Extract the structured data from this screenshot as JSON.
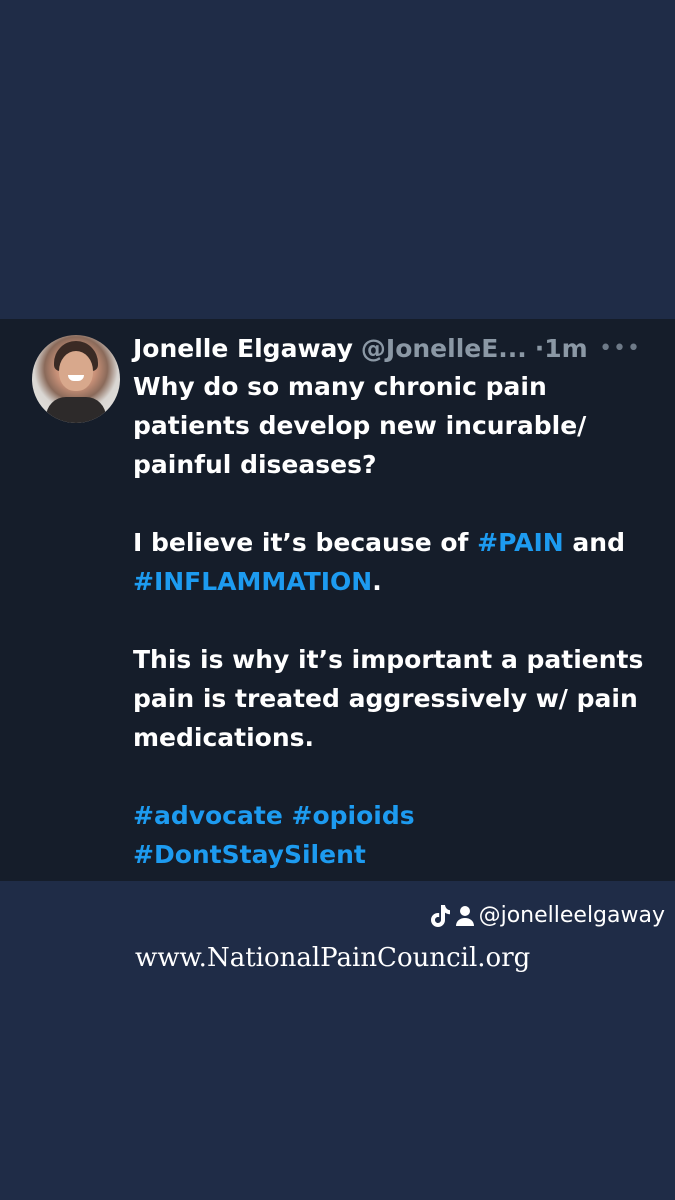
{
  "tweet": {
    "author": {
      "display_name": "Jonelle Elgaway",
      "handle": "@JonelleE...",
      "separator": "·",
      "time": "1m",
      "more_icon": "more-horizontal-icon"
    },
    "paragraphs": [
      [
        "Why do so many chronic pain patients develop new incurable/ painful diseases?"
      ],
      [
        "I believe it’s because of ",
        "#PAIN",
        " and ",
        "#INFLAMMATION",
        "."
      ],
      [
        "This is why it’s important a patients pain is treated aggressively w/ pain medications."
      ],
      [
        "#advocate",
        " ",
        "#opioids",
        " ",
        "#DontStaySilent"
      ]
    ],
    "hashtag_color": "#1d9bf0"
  },
  "credit": {
    "icons": [
      "tiktok-icon",
      "person-icon"
    ],
    "handle": "@jonelleelgaway"
  },
  "website": "www.NationalPainCouncil.org",
  "colors": {
    "background": "#1f2c47",
    "card": "#151d2a",
    "text": "#ffffff",
    "muted": "#8b98a5"
  }
}
